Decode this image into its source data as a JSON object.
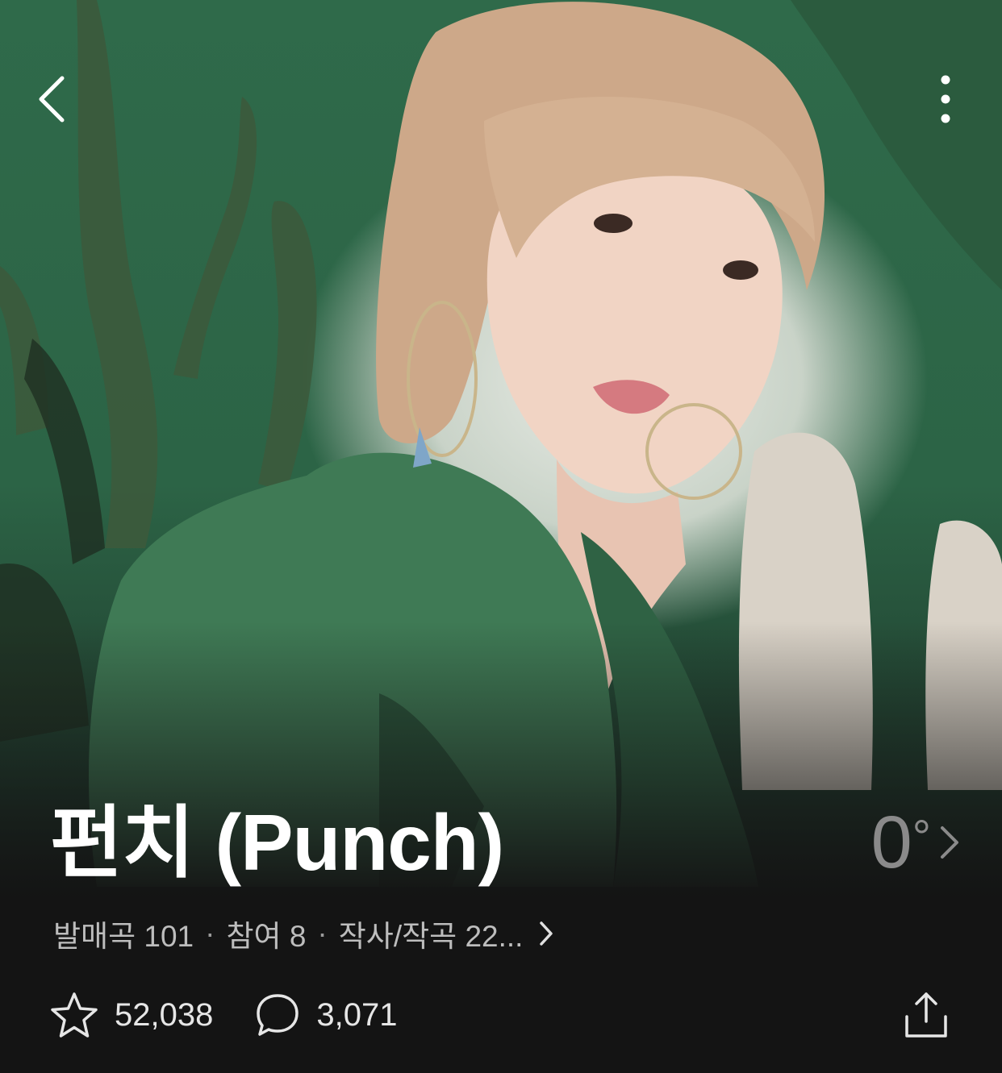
{
  "header": {
    "back_icon": "chevron-left-icon",
    "more_icon": "vertical-ellipsis-icon"
  },
  "artist": {
    "title": "펀치 (Punch)",
    "temperature": "0",
    "temperature_unit": "°"
  },
  "meta": {
    "releases": "발매곡 101",
    "participation": "참여 8",
    "credits": "작사/작곡 22...",
    "separator": "·"
  },
  "stats": {
    "likes": "52,038",
    "comments": "3,071",
    "like_icon": "star-outline-icon",
    "comment_icon": "speech-bubble-icon",
    "share_icon": "share-upload-icon"
  },
  "colors": {
    "background": "#141414",
    "text_primary": "#ffffff",
    "text_secondary": "#bdbdbd",
    "temperature": "#8a8a8a"
  }
}
